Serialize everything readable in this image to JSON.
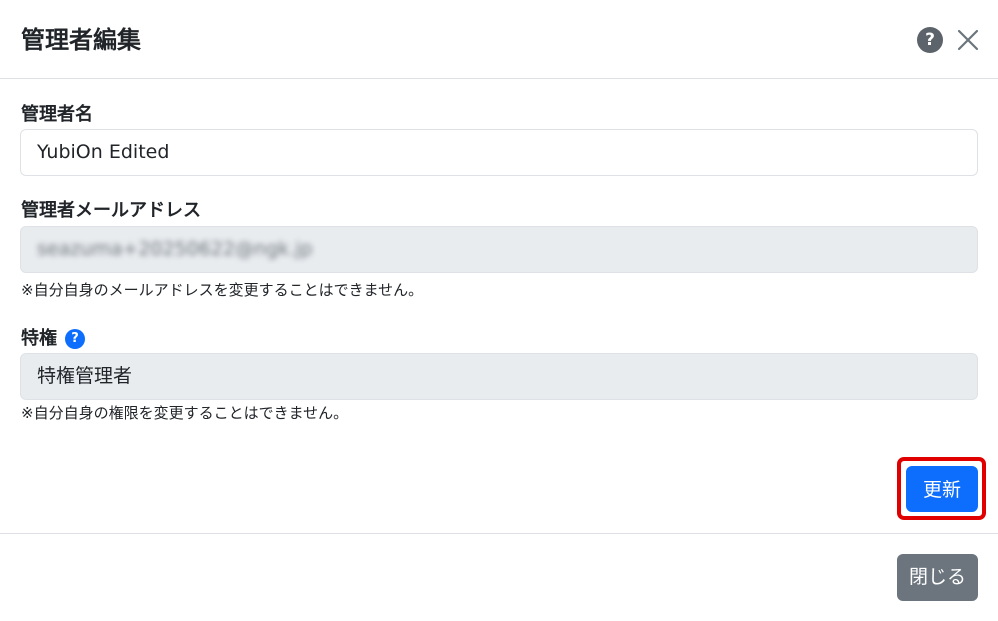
{
  "modal": {
    "title": "管理者編集",
    "help_icon_glyph": "?",
    "help_icon": "question-circle-icon",
    "close_icon": "close-icon"
  },
  "form": {
    "name": {
      "label": "管理者名",
      "value": "YubiOn Edited"
    },
    "email": {
      "label": "管理者メールアドレス",
      "value": "seazuma+20250622@ngk.jp",
      "note": "※自分自身のメールアドレスを変更することはできません。"
    },
    "privilege": {
      "label": "特権",
      "help_glyph": "?",
      "value": "特権管理者",
      "note": "※自分自身の権限を変更することはできません。"
    }
  },
  "actions": {
    "update_label": "更新",
    "close_label": "閉じる"
  },
  "colors": {
    "primary": "#0d6efd",
    "secondary": "#6c757d",
    "highlight": "#e10000",
    "disabled_bg": "#e9ecef"
  }
}
